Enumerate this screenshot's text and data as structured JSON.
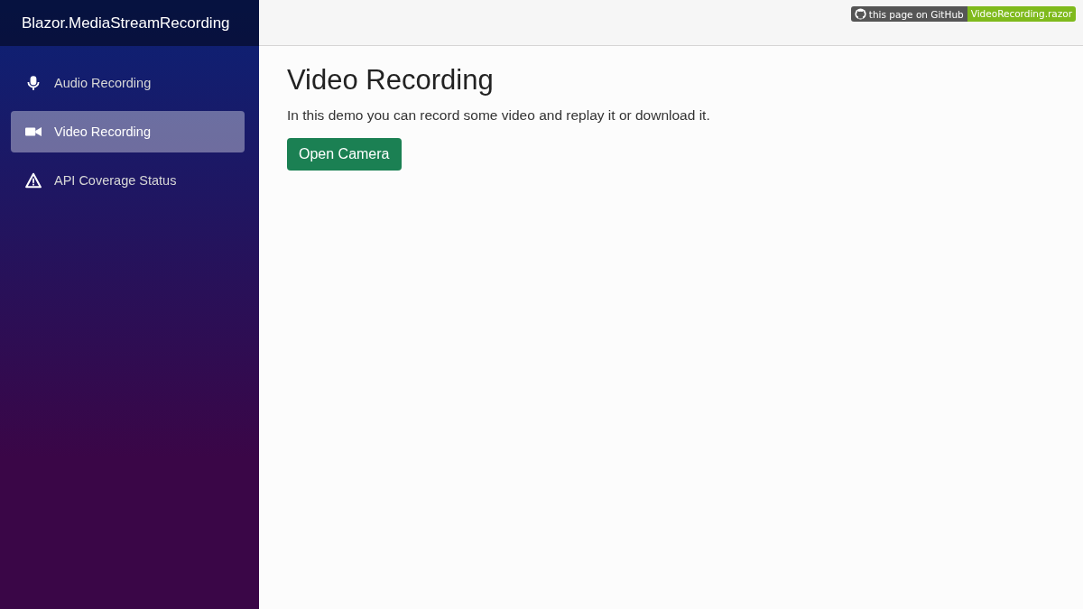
{
  "sidebar": {
    "brand": "Blazor.MediaStreamRecording",
    "items": [
      {
        "label": "Audio Recording",
        "kind": "mic",
        "selected": false
      },
      {
        "label": "Video Recording",
        "kind": "camera",
        "selected": true
      },
      {
        "label": "API Coverage Status",
        "kind": "warning",
        "selected": false
      }
    ]
  },
  "badge": {
    "left": "this page on GitHub",
    "right": "VideoRecording.razor"
  },
  "page": {
    "title": "Video Recording",
    "description": "In this demo you can record some video and replay it or download it.",
    "button": "Open Camera"
  }
}
